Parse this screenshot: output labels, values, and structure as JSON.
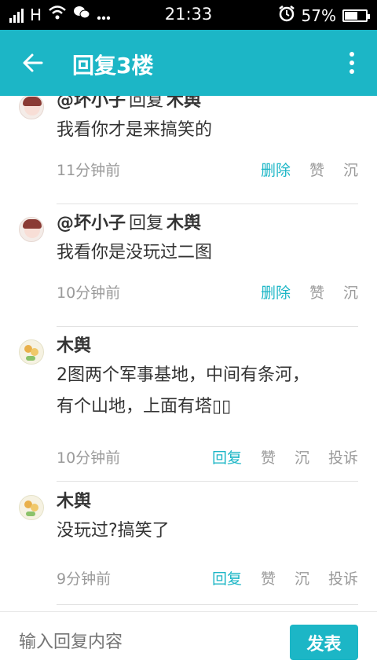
{
  "status_bar": {
    "network_label": "H",
    "time": "21:33",
    "battery_percent": "57%",
    "battery_level": 0.57
  },
  "app_bar": {
    "title": "回复3楼"
  },
  "comments": [
    {
      "user": "@坏小子",
      "reply_word": "回复",
      "target": "木舆",
      "content": "我看你才是来搞笑的",
      "time": "11分钟前",
      "actions": [
        "删除",
        "赞",
        "沉"
      ]
    },
    {
      "user": "@坏小子",
      "reply_word": "回复",
      "target": "木舆",
      "content": "我看你是没玩过二图",
      "time": "10分钟前",
      "actions": [
        "删除",
        "赞",
        "沉"
      ]
    },
    {
      "user": "木舆",
      "content_line1": "2图两个军事基地，中间有条河，",
      "content_line2": "有个山地，上面有塔▯▯",
      "time": "10分钟前",
      "actions": [
        "回复",
        "赞",
        "沉",
        "投诉"
      ]
    },
    {
      "user": "木舆",
      "content": "没玩过?搞笑了",
      "time": "9分钟前",
      "actions": [
        "回复",
        "赞",
        "沉",
        "投诉"
      ]
    }
  ],
  "reply_bar": {
    "placeholder": "输入回复内容",
    "send_label": "发表"
  },
  "colors": {
    "accent": "#1cb6c6"
  }
}
